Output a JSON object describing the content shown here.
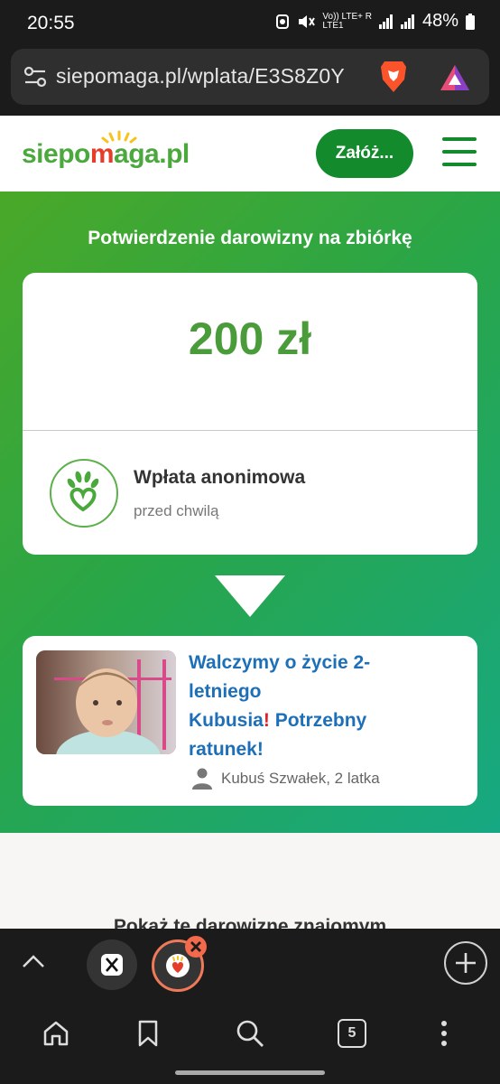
{
  "status_bar": {
    "time": "20:55",
    "network_label": "Vo)) LTE+ R\nLTE1",
    "battery": "48%"
  },
  "browser": {
    "url": "siepomaga.pl/wplata/E3S8Z0Y",
    "tab_count": "5"
  },
  "site_header": {
    "logo_part1": "siepo",
    "logo_part2": "m",
    "logo_part3": "aga.pl",
    "cta_label": "Załóż..."
  },
  "main": {
    "title": "Potwierdzenie darowizny na zbiórkę",
    "donation": {
      "amount": "200 zł",
      "donor_name": "Wpłata anonimowa",
      "donor_time": "przed chwilą"
    },
    "campaign": {
      "title_line1": "Walczymy o życie 2-",
      "title_line2": "letniego",
      "title_line3a": "Kubusia",
      "title_line3b": "Potrzebny",
      "title_line4": "ratunek!",
      "author": "Kubuś Szwałek, 2 latka"
    },
    "below_text": "Pokaż tę darowiznę znajomym"
  },
  "colors": {
    "brand_green": "#138a2c",
    "amount_green": "#4a9c3a",
    "link_blue": "#1d6fb8",
    "accent_orange": "#ef7a58"
  }
}
